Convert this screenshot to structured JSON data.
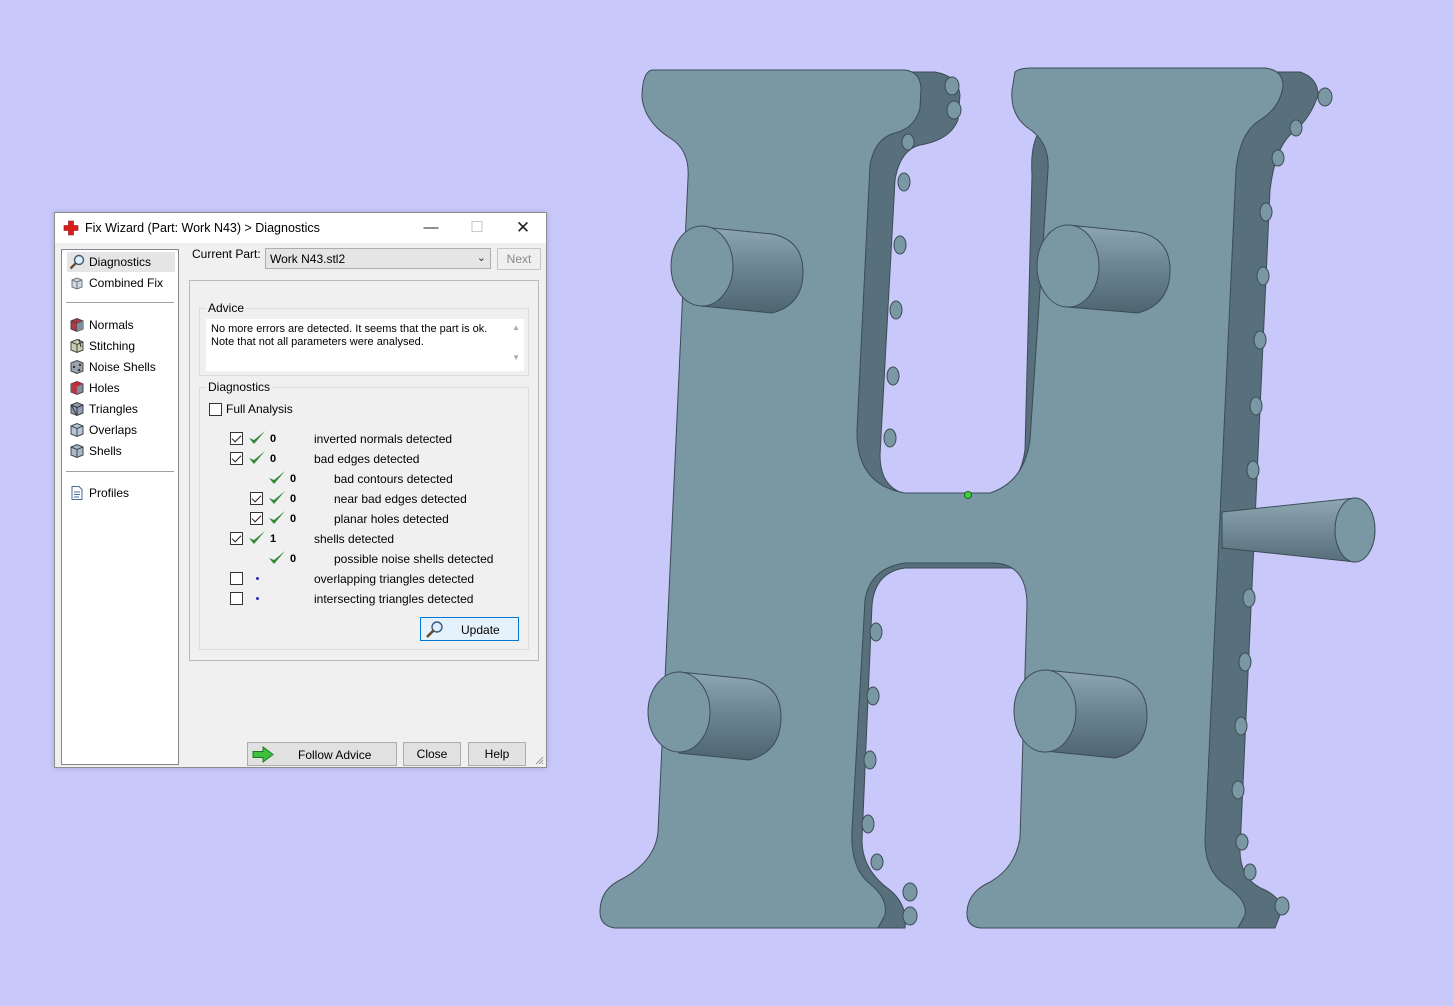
{
  "window": {
    "title": "Fix Wizard (Part: Work N43) > Diagnostics",
    "minimize_symbol": "—",
    "maximize_symbol": "☐",
    "close_symbol": "✕"
  },
  "sidebar": {
    "items": [
      {
        "label": "Diagnostics",
        "icon": "magnifier-icon",
        "selected": true
      },
      {
        "label": "Combined Fix",
        "icon": "combined-fix-icon"
      },
      {
        "label": "Normals",
        "icon": "normals-cube-icon"
      },
      {
        "label": "Stitching",
        "icon": "stitching-cube-icon"
      },
      {
        "label": "Noise Shells",
        "icon": "noise-shells-cube-icon"
      },
      {
        "label": "Holes",
        "icon": "holes-cube-icon"
      },
      {
        "label": "Triangles",
        "icon": "triangles-cube-icon"
      },
      {
        "label": "Overlaps",
        "icon": "overlaps-cube-icon"
      },
      {
        "label": "Shells",
        "icon": "shells-cube-icon"
      },
      {
        "label": "Profiles",
        "icon": "profiles-document-icon"
      }
    ]
  },
  "current_part": {
    "label": "Current Part:",
    "value": "Work N43.stl2",
    "next_label": "Next"
  },
  "advice": {
    "title": "Advice",
    "text": "No more errors are detected. It seems that the part is ok. Note that not all parameters were analysed."
  },
  "diagnostics": {
    "title": "Diagnostics",
    "full_analysis_label": "Full Analysis",
    "full_analysis_checked": false,
    "rows": [
      {
        "checkbox": true,
        "checked": true,
        "status": "ok",
        "count": "0",
        "label": "inverted normals detected",
        "indent": 0
      },
      {
        "checkbox": true,
        "checked": true,
        "status": "ok",
        "count": "0",
        "label": "bad edges detected",
        "indent": 0
      },
      {
        "checkbox": false,
        "checked": false,
        "status": "ok",
        "count": "0",
        "label": "bad contours detected",
        "indent": 1
      },
      {
        "checkbox": true,
        "checked": true,
        "status": "ok",
        "count": "0",
        "label": "near bad edges detected",
        "indent": 1
      },
      {
        "checkbox": true,
        "checked": true,
        "status": "ok",
        "count": "0",
        "label": "planar holes detected",
        "indent": 1
      },
      {
        "checkbox": true,
        "checked": true,
        "status": "ok",
        "count": "1",
        "label": "shells detected",
        "indent": 0
      },
      {
        "checkbox": false,
        "checked": false,
        "status": "ok",
        "count": "0",
        "label": "possible noise shells detected",
        "indent": 1
      },
      {
        "checkbox": true,
        "checked": false,
        "status": "none",
        "count": "",
        "label": "overlapping triangles detected",
        "indent": 0
      },
      {
        "checkbox": true,
        "checked": false,
        "status": "none",
        "count": "",
        "label": "intersecting triangles detected",
        "indent": 0
      }
    ],
    "update_label": "Update"
  },
  "footer": {
    "follow_advice_label": "Follow Advice",
    "close_label": "Close",
    "help_label": "Help"
  },
  "colors": {
    "viewport_background": "#c8c8fa",
    "model_face": "#7a97a4",
    "model_side": "#5b7480",
    "model_outline": "#3c4c54",
    "tick_green": "#2f8a3a",
    "selection_point": "#3dd13d"
  }
}
